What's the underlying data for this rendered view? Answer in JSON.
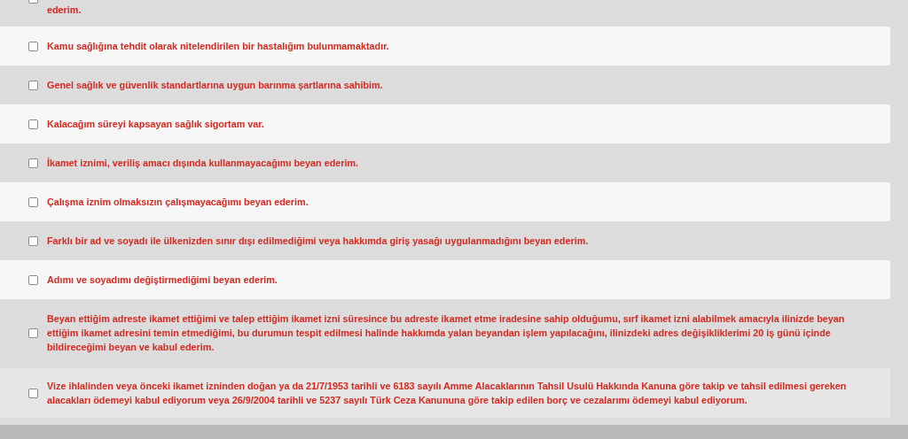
{
  "declarations": [
    {
      "text": "ederim.",
      "checked": false
    },
    {
      "text": "Kamu sağlığına tehdit olarak nitelendirilen bir hastalığım bulunmamaktadır.",
      "checked": false
    },
    {
      "text": "Genel sağlık ve güvenlik standartlarına uygun barınma şartlarına sahibim.",
      "checked": false
    },
    {
      "text": "Kalacağım süreyi kapsayan sağlık sigortam var.",
      "checked": false
    },
    {
      "text": "İkamet iznimi, veriliş amacı dışında kullanmayacağımı beyan ederim.",
      "checked": false
    },
    {
      "text": "Çalışma iznim olmaksızın çalışmayacağımı beyan ederim.",
      "checked": false
    },
    {
      "text": "Farklı bir ad ve soyadı ile ülkenizden sınır dışı edilmediğimi veya hakkımda giriş yasağı uygulanmadığını beyan ederim.",
      "checked": false
    },
    {
      "text": "Adımı ve soyadımı değiştirmediğimi beyan ederim.",
      "checked": false
    },
    {
      "text": "Beyan ettiğim adreste ikamet ettiğimi ve talep ettiğim ikamet izni süresince bu adreste ikamet etme iradesine sahip olduğumu, sırf ikamet izni alabilmek amacıyla ilinizde beyan ettiğim ikamet adresini temin etmediğimi, bu durumun tespit edilmesi halinde hakkımda yalan beyandan işlem yapılacağını, ilinizdeki adres değişikliklerimi 20 iş günü içinde bildireceğimi beyan ve kabul ederim.",
      "checked": false
    },
    {
      "text": "Vize ihlalinden veya önceki ikamet izninden doğan ya da 21/7/1953 tarihli ve 6183 sayılı Amme Alacaklarının Tahsil Usulü Hakkında Kanuna göre takip ve tahsil edilmesi gereken alacakları ödemeyi kabul ediyorum veya 26/9/2004 tarihli ve 5237 sayılı Türk Ceza Kanununa göre takip edilen borç ve cezalarımı ödemeyi kabul ediyorum.",
      "checked": false
    }
  ]
}
